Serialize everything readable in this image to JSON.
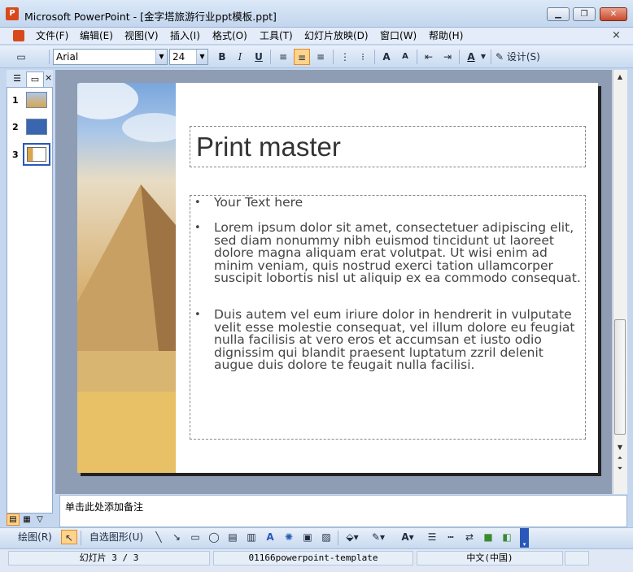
{
  "window": {
    "title": "Microsoft PowerPoint - [金字塔旅游行业ppt模板.ppt]",
    "minimize": "▁",
    "restore": "❐",
    "close": "✕"
  },
  "menu": {
    "items": [
      "文件(F)",
      "编辑(E)",
      "视图(V)",
      "插入(I)",
      "格式(O)",
      "工具(T)",
      "幻灯片放映(D)",
      "窗口(W)",
      "帮助(H)"
    ],
    "close_doc": "×"
  },
  "toolbar": {
    "font": "Arial",
    "size": "24",
    "bold": "B",
    "italic": "I",
    "underline": "U",
    "font_color": "A",
    "design": "设计(S)"
  },
  "thumbnails": {
    "numbers": [
      "1",
      "2",
      "3"
    ],
    "selected": 3
  },
  "slide": {
    "title": "Print master",
    "bullets": [
      "Your Text here",
      "Lorem ipsum dolor sit amet, consectetuer adipiscing elit, sed diam nonummy nibh euismod tincidunt ut laoreet dolore magna aliquam erat volutpat. Ut wisi enim ad minim veniam, quis nostrud exerci tation ullamcorper suscipit lobortis nisl ut aliquip ex ea commodo consequat.",
      "Duis autem vel eum iriure dolor in hendrerit in vulputate velit esse molestie consequat, vel illum dolore eu feugiat nulla facilisis at vero eros et accumsan et iusto odio dignissim qui blandit praesent luptatum zzril delenit augue duis dolore te feugait nulla facilisi."
    ]
  },
  "notes": {
    "placeholder": "单击此处添加备注"
  },
  "drawing": {
    "draw": "绘图(R)",
    "autoshapes": "自选图形(U)"
  },
  "status": {
    "slide": "幻灯片 3 / 3",
    "template": "01166powerpoint-template",
    "language": "中文(中国)"
  },
  "colors": {
    "accent_selected": "#ffd48a",
    "slide_title": "#333333",
    "chrome": "#c5d7ee"
  }
}
